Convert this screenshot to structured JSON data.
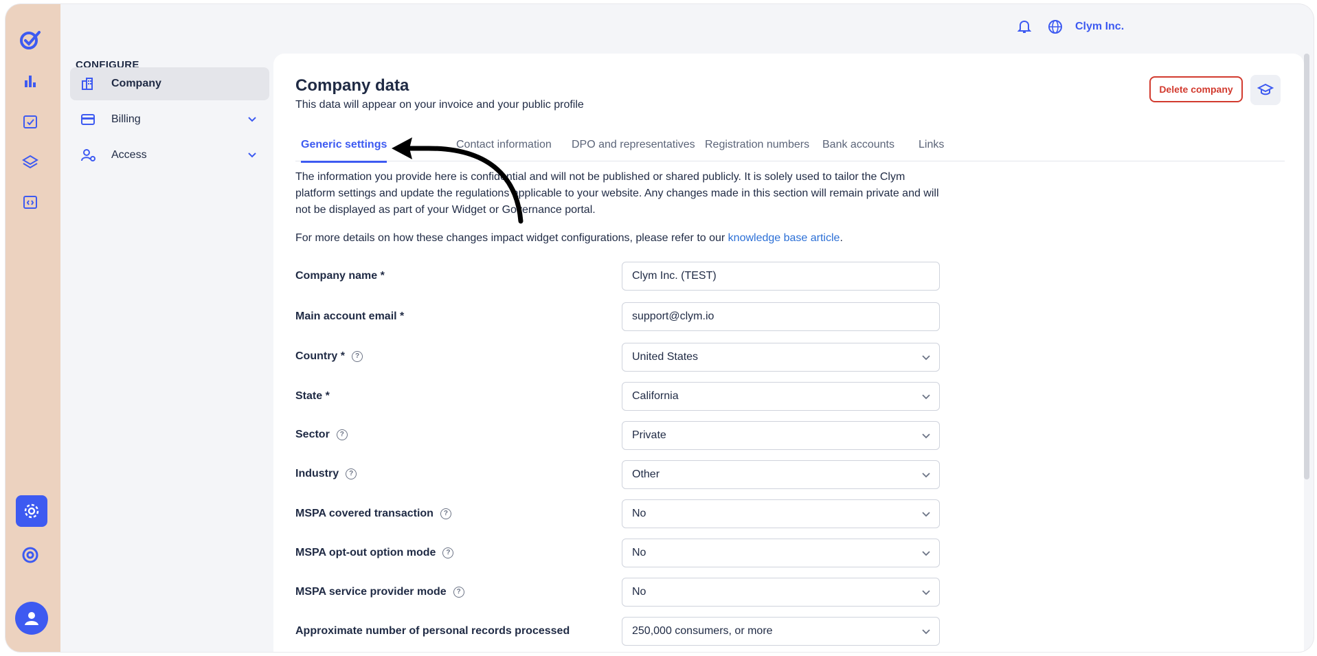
{
  "topbar": {
    "company": "Clym Inc."
  },
  "icons": {
    "logo": "clym-logo-icon",
    "rail": [
      "analytics-icon",
      "checklist-icon",
      "layers-icon",
      "code-icon",
      "settings-icon",
      "lifebuoy-icon",
      "user-icon"
    ],
    "bell": "bell-icon",
    "globe": "globe-icon"
  },
  "sidebar": {
    "title": "CONFIGURE",
    "items": [
      {
        "label": "Company",
        "icon": "building-icon",
        "active": true
      },
      {
        "label": "Billing",
        "icon": "credit-card-icon"
      },
      {
        "label": "Access",
        "icon": "user-gear-icon"
      }
    ]
  },
  "page": {
    "title": "Company data",
    "subtitle": "This data will appear on your invoice and your public profile",
    "delete_label": "Delete company"
  },
  "tabs": [
    "Generic settings",
    "Contact information",
    "DPO and representatives",
    "Registration numbers",
    "Bank accounts",
    "Links"
  ],
  "info": {
    "line1": "The information you provide here is confidential and will not be published or shared publicly. It is solely used to tailor the Clym platform settings and update the regulations applicable to your website. Any changes made in this section will remain private and will not be displayed as part of your Widget or Governance portal.",
    "line2_prefix": "For more details on how these changes impact widget configurations, please refer to our ",
    "line2_link": "knowledge base article",
    "line2_suffix": "."
  },
  "form": {
    "company_name": {
      "label": "Company name *",
      "value": "Clym Inc. (TEST)"
    },
    "email": {
      "label": "Main account email *",
      "value": "support@clym.io"
    },
    "country": {
      "label": "Country *",
      "value": "United States"
    },
    "state": {
      "label": "State *",
      "value": "California"
    },
    "sector": {
      "label": "Sector",
      "value": "Private"
    },
    "industry": {
      "label": "Industry",
      "value": "Other"
    },
    "mspa_covered": {
      "label": "MSPA covered transaction",
      "value": "No"
    },
    "mspa_optout": {
      "label": "MSPA opt-out option mode",
      "value": "No"
    },
    "mspa_service": {
      "label": "MSPA service provider mode",
      "value": "No"
    },
    "records": {
      "label": "Approximate number of personal records processed",
      "value": "250,000 consumers, or more"
    }
  },
  "colors": {
    "accent": "#3d5af1",
    "danger": "#d23a2e",
    "rail": "#ecd2bf"
  }
}
